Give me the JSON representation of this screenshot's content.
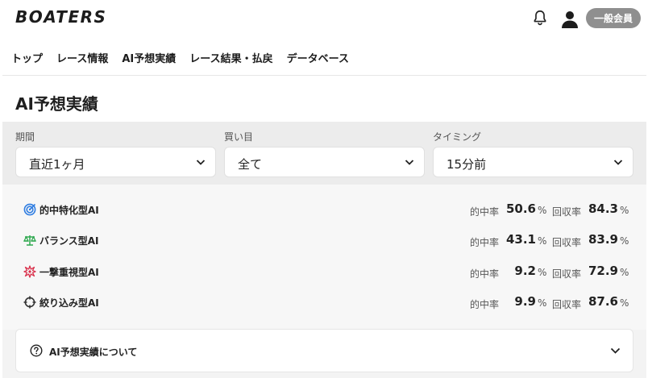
{
  "header": {
    "logo": "BOATERS",
    "member_badge": "一般会員",
    "icons": [
      "bell-icon",
      "user-avatar-icon"
    ]
  },
  "nav": {
    "items": [
      {
        "label": "トップ"
      },
      {
        "label": "レース情報"
      },
      {
        "label": "AI予想実績"
      },
      {
        "label": "レース結果・払戻"
      },
      {
        "label": "データベース"
      }
    ]
  },
  "page": {
    "title": "AI予想実績"
  },
  "filters": [
    {
      "label": "期間",
      "value": "直近1ヶ月"
    },
    {
      "label": "買い目",
      "value": "全て"
    },
    {
      "label": "タイミング",
      "value": "15分前"
    }
  ],
  "stats": {
    "hit_label": "的中率",
    "return_label": "回収率",
    "percent": "%",
    "rows": [
      {
        "name": "的中特化型AI",
        "hit": "50.6",
        "return": "84.3",
        "icon": "target-icon",
        "color": "#2f7de1"
      },
      {
        "name": "バランス型AI",
        "hit": "43.1",
        "return": "83.9",
        "icon": "scale-icon",
        "color": "#2fa84f"
      },
      {
        "name": "一撃重視型AI",
        "hit": "9.2",
        "return": "72.9",
        "icon": "burst-icon",
        "color": "#d9304b"
      },
      {
        "name": "絞り込み型AI",
        "hit": "9.9",
        "return": "87.6",
        "icon": "crosshair-icon",
        "color": "#333333"
      }
    ]
  },
  "about": {
    "label": "AI予想実績について",
    "icon": "question-circle-icon"
  }
}
